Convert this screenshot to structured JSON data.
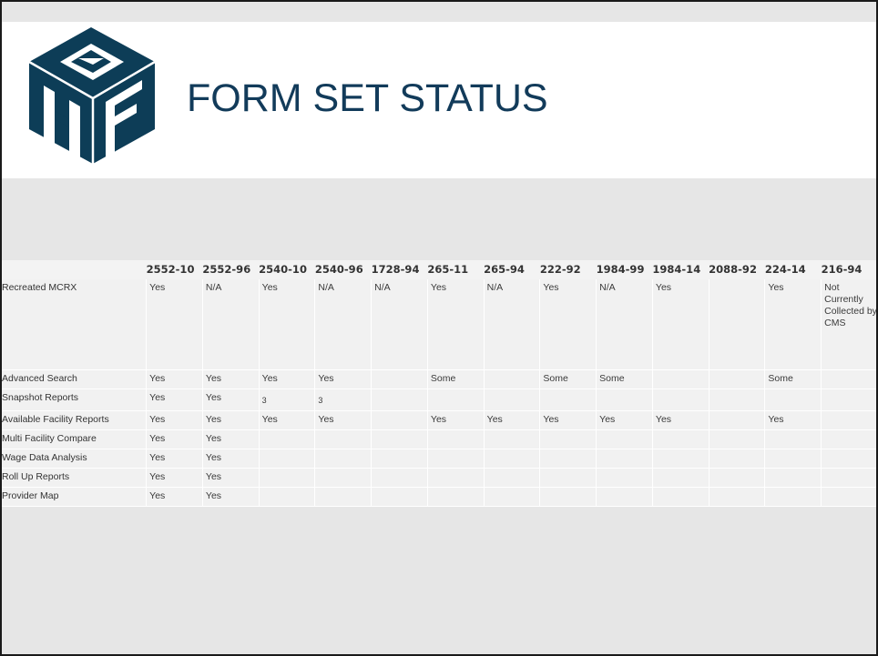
{
  "title": "FORM SET STATUS",
  "brand": {
    "primary_color": "#0d3d57",
    "logo_letters": "HF"
  },
  "table": {
    "columns": [
      "2552-10",
      "2552-96",
      "2540-10",
      "2540-96",
      "1728-94",
      "265-11",
      "265-94",
      "222-92",
      "1984-99",
      "1984-14",
      "2088-92",
      "224-14",
      "216-94"
    ],
    "rows": [
      {
        "label": "Recreated MCRX",
        "cells": [
          "Yes",
          "N/A",
          "Yes",
          "N/A",
          "N/A",
          "Yes",
          "N/A",
          "Yes",
          "N/A",
          "Yes",
          "",
          "Yes",
          "Not Currently Collected by CMS"
        ]
      },
      {
        "label": "Advanced Search",
        "cells": [
          "Yes",
          "Yes",
          "Yes",
          "Yes",
          "",
          "Some",
          "",
          "Some",
          "Some",
          "",
          "",
          "Some",
          ""
        ]
      },
      {
        "label": "Snapshot Reports",
        "cells": [
          "Yes",
          "Yes",
          "3",
          "3",
          "",
          "",
          "",
          "",
          "",
          "",
          "",
          "",
          ""
        ]
      },
      {
        "label": "Available Facility Reports",
        "cells": [
          "Yes",
          "Yes",
          "Yes",
          "Yes",
          "",
          "Yes",
          "Yes",
          "Yes",
          "Yes",
          "Yes",
          "",
          "Yes",
          ""
        ]
      },
      {
        "label": "Multi Facility Compare",
        "cells": [
          "Yes",
          "Yes",
          "",
          "",
          "",
          "",
          "",
          "",
          "",
          "",
          "",
          "",
          ""
        ]
      },
      {
        "label": "Wage Data Analysis",
        "cells": [
          "Yes",
          "Yes",
          "",
          "",
          "",
          "",
          "",
          "",
          "",
          "",
          "",
          "",
          ""
        ]
      },
      {
        "label": "Roll Up Reports",
        "cells": [
          "Yes",
          "Yes",
          "",
          "",
          "",
          "",
          "",
          "",
          "",
          "",
          "",
          "",
          ""
        ]
      },
      {
        "label": "Provider Map",
        "cells": [
          "Yes",
          "Yes",
          "",
          "",
          "",
          "",
          "",
          "",
          "",
          "",
          "",
          "",
          ""
        ]
      }
    ]
  }
}
